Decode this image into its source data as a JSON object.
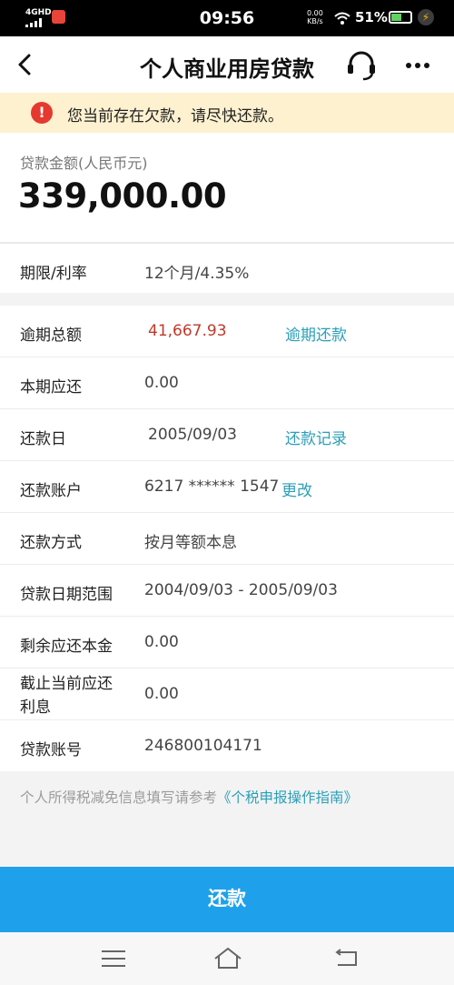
{
  "status_bar": {
    "network": "4GHD",
    "time": "09:56",
    "speed_value": "0.00",
    "speed_unit": "KB/s",
    "battery": "51%"
  },
  "header": {
    "title": "个人商业用房贷款",
    "back_icon": "chevron-left-icon",
    "support_icon": "headset-icon",
    "more_icon": "more-dots-icon"
  },
  "notice": {
    "icon": "!",
    "text": "您当前存在欠款，请尽快还款。"
  },
  "loan": {
    "amount_label": "贷款金额(人民币元)",
    "amount": "339,000.00"
  },
  "term": {
    "label": "期限/利率",
    "value": "12个月/4.35%"
  },
  "details": {
    "overdue_total": {
      "label": "逾期总额",
      "value": "41,667.93",
      "link": "逾期还款"
    },
    "current_due": {
      "label": "本期应还",
      "value": "0.00"
    },
    "repay_day": {
      "label": "还款日",
      "value": "2005/09/03",
      "link": "还款记录"
    },
    "repay_account": {
      "label": "还款账户",
      "value": "6217 ****** 1547",
      "link": "更改"
    },
    "repay_method": {
      "label": "还款方式",
      "value": "按月等额本息"
    },
    "loan_date_range": {
      "label": "贷款日期范围",
      "value": "2004/09/03 - 2005/09/03"
    },
    "remaining_principal": {
      "label": "剩余应还本金",
      "value": "0.00"
    },
    "interest_due_line1": "截止当前应还",
    "interest_due_line2": "利息",
    "interest_due_value": "0.00",
    "loan_account": {
      "label": "贷款账号",
      "value": "246800104171"
    }
  },
  "tax": {
    "note": "个人所得税减免信息填写请参考",
    "link": "《个税申报操作指南》"
  },
  "repay_button": "还款",
  "colors": {
    "accent": "#1ea1ea",
    "link": "#2b9fb8",
    "overdue": "#c0392b",
    "notice_bg": "#fdf1cf"
  }
}
